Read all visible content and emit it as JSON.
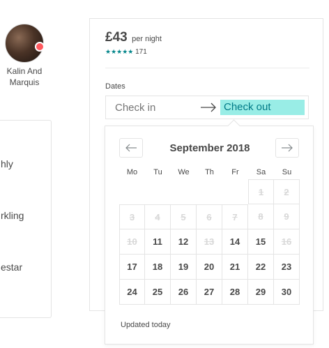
{
  "host": {
    "name": "Kalin And Marquis"
  },
  "left_card": {
    "snippets": [
      "hly",
      "rkling",
      "estar"
    ]
  },
  "booking": {
    "price": "£43",
    "price_unit": "per night",
    "stars": "★★★★★",
    "rating": 5,
    "review_count": "171",
    "dates_label": "Dates",
    "check_in": "Check in",
    "check_out": "Check out"
  },
  "calendar": {
    "month_title": "September 2018",
    "weekdays": [
      "Mo",
      "Tu",
      "We",
      "Th",
      "Fr",
      "Sa",
      "Su"
    ],
    "weeks": [
      [
        {
          "d": "",
          "b": false
        },
        {
          "d": "",
          "b": false
        },
        {
          "d": "",
          "b": false
        },
        {
          "d": "",
          "b": false
        },
        {
          "d": "",
          "b": false
        },
        {
          "d": "1",
          "b": true
        },
        {
          "d": "2",
          "b": true
        }
      ],
      [
        {
          "d": "3",
          "b": true
        },
        {
          "d": "4",
          "b": true
        },
        {
          "d": "5",
          "b": true
        },
        {
          "d": "6",
          "b": true
        },
        {
          "d": "7",
          "b": true
        },
        {
          "d": "8",
          "b": true
        },
        {
          "d": "9",
          "b": true
        }
      ],
      [
        {
          "d": "10",
          "b": true
        },
        {
          "d": "11",
          "b": false
        },
        {
          "d": "12",
          "b": false
        },
        {
          "d": "13",
          "b": true
        },
        {
          "d": "14",
          "b": false
        },
        {
          "d": "15",
          "b": false
        },
        {
          "d": "16",
          "b": true
        }
      ],
      [
        {
          "d": "17",
          "b": false
        },
        {
          "d": "18",
          "b": false
        },
        {
          "d": "19",
          "b": false
        },
        {
          "d": "20",
          "b": false
        },
        {
          "d": "21",
          "b": false
        },
        {
          "d": "22",
          "b": false
        },
        {
          "d": "23",
          "b": false
        }
      ],
      [
        {
          "d": "24",
          "b": false
        },
        {
          "d": "25",
          "b": false
        },
        {
          "d": "26",
          "b": false
        },
        {
          "d": "27",
          "b": false
        },
        {
          "d": "28",
          "b": false
        },
        {
          "d": "29",
          "b": false
        },
        {
          "d": "30",
          "b": false
        }
      ]
    ],
    "updated": "Updated today"
  },
  "colors": {
    "accent": "#008489",
    "selected_bg": "#99ede6",
    "badge": "#ff5a5f"
  }
}
